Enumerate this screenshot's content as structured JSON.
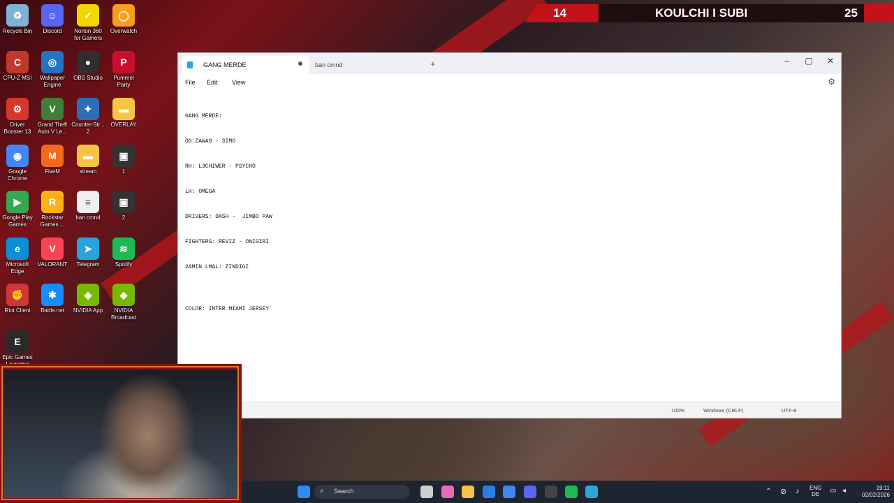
{
  "scoreboard": {
    "left_score": "14",
    "title": "KOULCHI I SUBI",
    "right_score": "25"
  },
  "desktop_icons": [
    {
      "label": "Recycle Bin",
      "icon": "recycle-bin-icon",
      "color": "#7fb3d5"
    },
    {
      "label": "Discord",
      "icon": "discord-icon",
      "color": "#5865f2"
    },
    {
      "label": "Norton 360 for Gamers",
      "icon": "norton-icon",
      "color": "#f2d600"
    },
    {
      "label": "Overwatch",
      "icon": "overwatch-icon",
      "color": "#f99e1a"
    },
    {
      "label": "CPU-Z MSI",
      "icon": "cpuz-icon",
      "color": "#c0392b"
    },
    {
      "label": "Wallpaper Engine",
      "icon": "wallpaper-engine-icon",
      "color": "#2474c6"
    },
    {
      "label": "OBS Studio",
      "icon": "obs-icon",
      "color": "#302e31"
    },
    {
      "label": "Pummel Party",
      "icon": "pummel-party-icon",
      "color": "#c8102e"
    },
    {
      "label": "Driver Booster 13",
      "icon": "driver-booster-icon",
      "color": "#d6372b"
    },
    {
      "label": "Grand Theft Auto V Le...",
      "icon": "gta-icon",
      "color": "#3f7d3a"
    },
    {
      "label": "Counter-Str... 2",
      "icon": "counter-strike-icon",
      "color": "#2d6fb7"
    },
    {
      "label": "OVERLAY",
      "icon": "folder-icon",
      "color": "#f4c542"
    },
    {
      "label": "Google Chrome",
      "icon": "chrome-icon",
      "color": "#4285f4"
    },
    {
      "label": "FiveM",
      "icon": "fivem-icon",
      "color": "#f26b1d"
    },
    {
      "label": "stream",
      "icon": "folder-icon",
      "color": "#f4c542"
    },
    {
      "label": "1",
      "icon": "image-file-icon",
      "color": "#333333"
    },
    {
      "label": "Google Play Games",
      "icon": "google-play-games-icon",
      "color": "#34a853"
    },
    {
      "label": "Rockstar Games ...",
      "icon": "rockstar-icon",
      "color": "#fcaf17"
    },
    {
      "label": "ban cmnd",
      "icon": "text-file-icon",
      "color": "#f0f0f0"
    },
    {
      "label": "2",
      "icon": "image-file-icon",
      "color": "#333333"
    },
    {
      "label": "Microsoft Edge",
      "icon": "edge-icon",
      "color": "#0c8fd6"
    },
    {
      "label": "VALORANT",
      "icon": "valorant-icon",
      "color": "#fa4454"
    },
    {
      "label": "Telegram",
      "icon": "telegram-icon",
      "color": "#2aa3dd"
    },
    {
      "label": "Spotify",
      "icon": "spotify-icon",
      "color": "#1db954"
    },
    {
      "label": "Riot Client",
      "icon": "riot-client-icon",
      "color": "#d13639"
    },
    {
      "label": "Battle.net",
      "icon": "battlenet-icon",
      "color": "#148eff"
    },
    {
      "label": "NVIDIA App",
      "icon": "nvidia-icon",
      "color": "#76b900"
    },
    {
      "label": "NVIDIA Broadcast",
      "icon": "nvidia-broadcast-icon",
      "color": "#76b900"
    },
    {
      "label": "Epic Games Launcher",
      "icon": "epic-games-icon",
      "color": "#2a2a2a"
    }
  ],
  "notepad": {
    "tabs": [
      {
        "label": "GANG MERDE",
        "unsaved": true
      },
      {
        "label": "ban cmnd"
      }
    ],
    "new_tab": "+",
    "window_controls": {
      "minimize": "–",
      "maximize": "▢",
      "close": "✕"
    },
    "menu": [
      "File",
      "Edit",
      "View"
    ],
    "lines": [
      "GANG MERDE:",
      "OG:ZAWA9 - SIMO",
      "RH: L3CHIWER - PSYCHO",
      "LH: OMEGA",
      "DRIVERS: DASH -  JIMBO PAW",
      "FIGHTERS: REVIZ - ONIGIRI",
      "2AMIN LMAL: ZINDIGI",
      "",
      "COLOR: INTER MIAMI JERSEY"
    ],
    "status": {
      "zoom": "100%",
      "line_ending": "Windows (CRLF)",
      "encoding": "UTF-8"
    }
  },
  "taskbar": {
    "search_placeholder": "Search",
    "apps": [
      {
        "icon": "start-icon",
        "color": "#2f8cf0"
      },
      {
        "icon": "task-view-icon",
        "color": "#cfcfcf"
      },
      {
        "icon": "copilot-icon",
        "color": "#e86bb3"
      },
      {
        "icon": "file-explorer-icon",
        "color": "#f4c542"
      },
      {
        "icon": "store-icon",
        "color": "#2a7de1"
      },
      {
        "icon": "chrome-icon",
        "color": "#4285f4"
      },
      {
        "icon": "discord-icon",
        "color": "#5865f2"
      },
      {
        "icon": "obs-icon",
        "color": "#444444"
      },
      {
        "icon": "spotify-icon",
        "color": "#1db954"
      },
      {
        "icon": "notepad-icon",
        "color": "#2aa7d9"
      }
    ],
    "tray": {
      "language": "ENG",
      "layout": "DE",
      "time": "19:11",
      "date": "02/02/2026"
    }
  }
}
